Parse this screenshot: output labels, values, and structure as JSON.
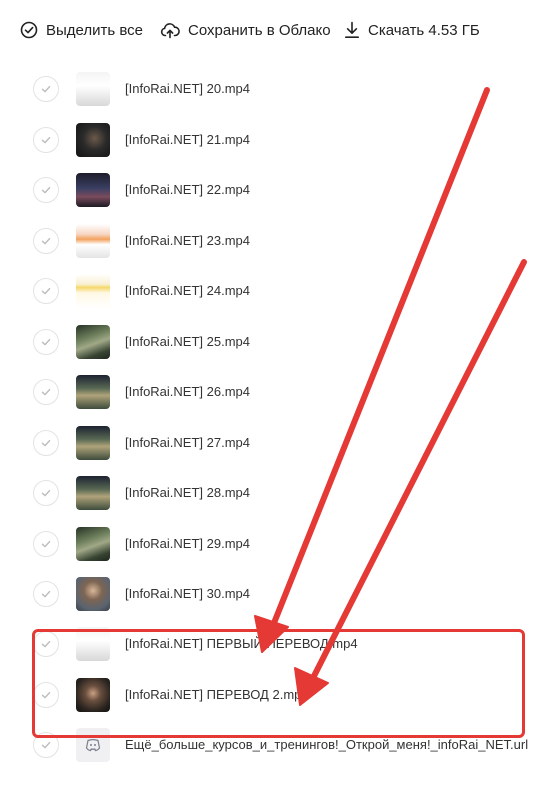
{
  "toolbar": {
    "select_all": {
      "label": "Выделить все",
      "icon": "check-circle-icon"
    },
    "save_cloud": {
      "label": "Сохранить в Облако",
      "icon": "cloud-upload-icon"
    },
    "download": {
      "label": "Скачать 4.53 ГБ",
      "icon": "download-icon"
    }
  },
  "files": [
    {
      "name": "",
      "thumb": "white"
    },
    {
      "name": "[InfoRai.NET] 20.mp4",
      "thumb": "white"
    },
    {
      "name": "[InfoRai.NET] 21.mp4",
      "thumb": "dark"
    },
    {
      "name": "[InfoRai.NET] 22.mp4",
      "thumb": "dash"
    },
    {
      "name": "[InfoRai.NET] 23.mp4",
      "thumb": "pink"
    },
    {
      "name": "[InfoRai.NET] 24.mp4",
      "thumb": "cream"
    },
    {
      "name": "[InfoRai.NET] 25.mp4",
      "thumb": "land"
    },
    {
      "name": "[InfoRai.NET] 26.mp4",
      "thumb": "land2"
    },
    {
      "name": "[InfoRai.NET] 27.mp4",
      "thumb": "land2"
    },
    {
      "name": "[InfoRai.NET] 28.mp4",
      "thumb": "land2"
    },
    {
      "name": "[InfoRai.NET] 29.mp4",
      "thumb": "land"
    },
    {
      "name": "[InfoRai.NET] 30.mp4",
      "thumb": "face"
    },
    {
      "name": "[InfoRai.NET] ПЕРВЫЙ ПЕРЕВОД.mp4",
      "thumb": "white"
    },
    {
      "name": "[InfoRai.NET] ПЕРЕВОД 2.mp4",
      "thumb": "face2"
    },
    {
      "name": "Ещё_больше_курсов_и_тренингов!_Открой_меня!_infoRai_NET.url",
      "thumb": "icon"
    }
  ],
  "annotation_color": "#e53935"
}
